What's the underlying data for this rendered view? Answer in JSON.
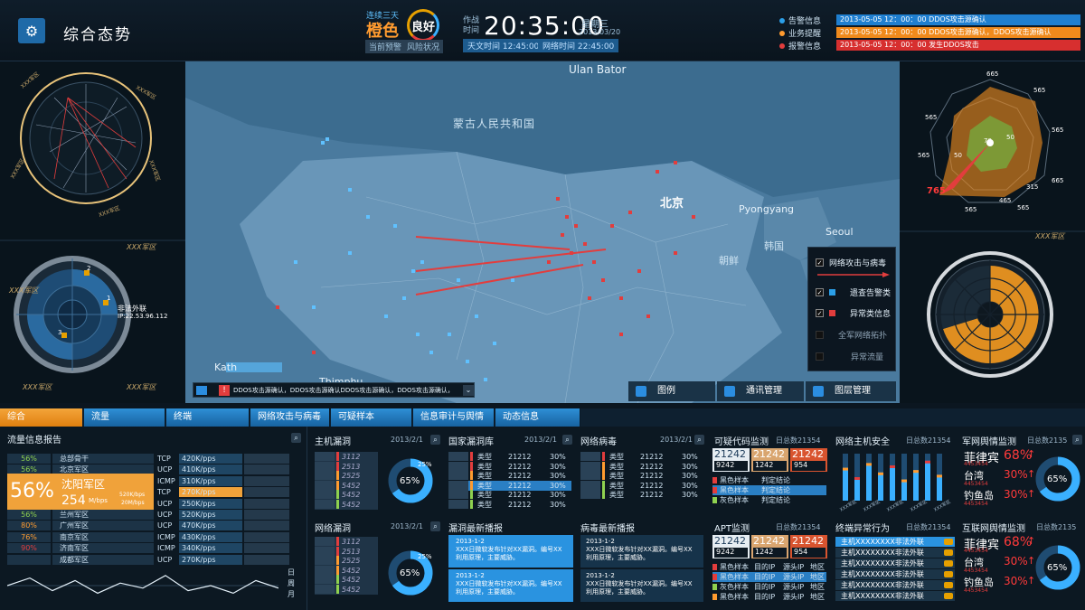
{
  "header": {
    "title": "综合态势",
    "combo_days": "连续三天",
    "level": "橙色",
    "level_label": "当前预警",
    "risk_value": "良好",
    "risk_label": "风险状况",
    "time_label": "作战时间",
    "clock": "20:35:00",
    "weekday": "星期三",
    "date": "2013/03/20",
    "sky_time": "天文时间 12:45:00",
    "net_time": "网络时间 22:45:00",
    "alerts": [
      {
        "label": "告警信息",
        "color": "#2b9fe8",
        "text": "2013-05-05 12：00：00 DDOS攻击源确认"
      },
      {
        "label": "业务提醒",
        "color": "#ff9b2f",
        "text": "2013-05-05 12：00：00 DDOS攻击源确认，DDOS攻击源确认"
      },
      {
        "label": "报警信息",
        "color": "#e23d3d",
        "text": "2013-05-05 12：00：00 发生DDOS攻击"
      }
    ]
  },
  "map": {
    "labels": {
      "ulan_bator": "Ulan Bator",
      "mongolia": "蒙古人民共和国",
      "beijing": "北京",
      "pyongyang": "Pyongyang",
      "seoul": "Seoul",
      "korea_s": "韩国",
      "korea_n": "朝鲜",
      "kath": "Kath",
      "thimphu": "Thimphu"
    },
    "ticker": "DDOS攻击源确认，DDOS攻击源确认DDOS攻击源确认，DDOS攻击源确认，",
    "legend": [
      {
        "label": "网络攻击与病毒",
        "checked": true
      },
      {
        "label": "遗查告警类",
        "checked": true,
        "color": "#2b9fe8"
      },
      {
        "label": "异常类信息",
        "checked": true,
        "color": "#e23d3d"
      },
      {
        "label": "全军网络拓扑",
        "checked": false
      },
      {
        "label": "异常流量",
        "checked": false
      }
    ],
    "buttons": [
      "图例",
      "通讯管理",
      "图层管理"
    ]
  },
  "left": {
    "radar_label": "非法外联",
    "radar_ip": "IP:22.53.96.112",
    "region_labels": [
      "XXX军区",
      "XXX军区",
      "XXX军区",
      "XXX军区"
    ],
    "points": [
      "1",
      "2",
      "3",
      "4"
    ]
  },
  "right": {
    "radar_values": [
      "665",
      "565",
      "565",
      "665",
      "565",
      "565",
      "565",
      "565",
      "765",
      "565",
      "565",
      "665",
      "565",
      "565",
      "565"
    ],
    "inner_values": [
      "50",
      "50",
      "50",
      "50",
      "50",
      "50",
      "50"
    ],
    "mid_values": [
      "35",
      "35",
      "125",
      "315",
      "465",
      "465"
    ],
    "core_value": "70",
    "region_label": "XXX军区"
  },
  "tabs": [
    "综合",
    "流量",
    "终端",
    "网络攻击与病毒",
    "可疑样本",
    "信息审计与舆情",
    "动态信息"
  ],
  "traffic": {
    "title": "流量信息报告",
    "rows": [
      {
        "pct": "56%",
        "name": "总部骨干",
        "proto": "TCP",
        "rate": "420K/pps"
      },
      {
        "pct": "56%",
        "name": "北京军区",
        "proto": "UCP",
        "rate": "410K/pps"
      },
      {
        "pct": "",
        "name": "",
        "proto": "ICMP",
        "rate": "310K/pps"
      },
      {
        "pct": "",
        "name": "",
        "proto": "TCP",
        "rate": "270K/pps"
      },
      {
        "pct": "",
        "name": "",
        "proto": "UCP",
        "rate": "250K/pps"
      },
      {
        "pct": "56%",
        "name": "兰州军区",
        "proto": "UCP",
        "rate": "520K/pps"
      },
      {
        "pct": "80%",
        "name": "广州军区",
        "proto": "UCP",
        "rate": "470K/pps"
      },
      {
        "pct": "76%",
        "name": "南京军区",
        "proto": "ICMP",
        "rate": "430K/pps"
      },
      {
        "pct": "90%",
        "name": "济南军区",
        "proto": "ICMP",
        "rate": "340K/pps"
      },
      {
        "pct": "",
        "name": "成都军区",
        "proto": "UCP",
        "rate": "270K/pps"
      }
    ],
    "highlight_pct": "56%",
    "highlight_name": "沈阳军区",
    "highlight_rate": "254",
    "highlight_unit": "M/bps",
    "highlight_sub1": "520K/bps",
    "highlight_sub2": "20M/bps",
    "range_labels": [
      "日",
      "周",
      "月"
    ],
    "wave": [
      0.5,
      0.8,
      0.3,
      0.7,
      0.2,
      0.6,
      0.4,
      0.9,
      0.3,
      0.5,
      0.2,
      0.7,
      0.4
    ]
  },
  "vuln_panels": [
    {
      "title": "主机漏洞",
      "date": "2013/2/1",
      "rows": [
        "3112",
        "2513",
        "2525",
        "5452",
        "5452",
        "5452"
      ],
      "pct": "65%",
      "sub": "25%"
    },
    {
      "title": "网络漏洞",
      "date": "2013/2/1",
      "rows": [
        "3112",
        "2513",
        "2525",
        "5452",
        "5452",
        "5452"
      ],
      "pct": "65%",
      "sub": "25%"
    }
  ],
  "vuln_lib": {
    "title": "国家漏洞库",
    "date": "2013/2/1",
    "rows": [
      {
        "type": "类型",
        "num": "21212",
        "pct": "30%"
      },
      {
        "type": "类型",
        "num": "21212",
        "pct": "30%"
      },
      {
        "type": "类型",
        "num": "21212",
        "pct": "30%"
      },
      {
        "type": "类型",
        "num": "21212",
        "pct": "30%"
      },
      {
        "type": "类型",
        "num": "21212",
        "pct": "30%"
      },
      {
        "type": "类型",
        "num": "21212",
        "pct": "30%"
      }
    ]
  },
  "virus": {
    "title": "网络病毒",
    "date": "2013/2/1",
    "rows": [
      {
        "type": "类型",
        "num": "21212",
        "pct": "30%"
      },
      {
        "type": "类型",
        "num": "21212",
        "pct": "30%"
      },
      {
        "type": "类型",
        "num": "21212",
        "pct": "30%"
      },
      {
        "type": "类型",
        "num": "21212",
        "pct": "30%"
      },
      {
        "type": "类型",
        "num": "21212",
        "pct": "30%"
      }
    ]
  },
  "vuln_news": {
    "title": "漏洞最新播报",
    "items": [
      {
        "date": "2013-1-2",
        "text": "XXX日微软发布针对XX漏洞。编号XX利用原理，主要威胁。"
      },
      {
        "date": "2013-1-2",
        "text": "XXX日微软发布针对XX漏洞。编号XX利用原理，主要威胁。"
      }
    ]
  },
  "virus_news": {
    "title": "病毒最新播报",
    "items": [
      {
        "date": "2013-1-2",
        "text": "XXX日微软发布针对XX漏洞。编号XX利用原理，主要威胁。"
      },
      {
        "date": "2013-1-2",
        "text": "XXX日微软发布针对XX漏洞。编号XX利用原理，主要威胁。"
      }
    ]
  },
  "suspicious": {
    "title": "可疑代码监测",
    "count": "日总数21354",
    "nums": [
      "21242",
      "21242",
      "21242"
    ],
    "subs": [
      "9242",
      "1242",
      "954"
    ],
    "rows": [
      {
        "a": "黑色样本",
        "b": "判定结论"
      },
      {
        "a": "黑色样本",
        "b": "判定结论"
      },
      {
        "a": "灰色样本",
        "b": "判定结论"
      }
    ]
  },
  "apt": {
    "title": "APT监测",
    "count": "日总数21354",
    "nums": [
      "21242",
      "21242",
      "21242"
    ],
    "subs": [
      "9242",
      "1242",
      "954"
    ],
    "rows": [
      {
        "a": "黑色样本",
        "b": "目的IP",
        "c": "源头IP",
        "d": "地区"
      },
      {
        "a": "黑色样本",
        "b": "目的IP",
        "c": "源头IP",
        "d": "地区"
      },
      {
        "a": "灰色样本",
        "b": "目的IP",
        "c": "源头IP",
        "d": "地区"
      },
      {
        "a": "黑色样本",
        "b": "目的IP",
        "c": "源头IP",
        "d": "地区"
      }
    ]
  },
  "host_security": {
    "title": "网络主机安全",
    "count": "日总数21354",
    "bars": [
      0.7,
      0.5,
      0.8,
      0.6,
      0.75,
      0.45,
      0.65,
      0.85,
      0.55
    ],
    "label": "XXX军区"
  },
  "endpoint": {
    "title": "终端异常行为",
    "count": "日总数21354",
    "rows": [
      "主机XXXXXXXX非法外联",
      "主机XXXXXXXX非法外联",
      "主机XXXXXXXX非法外联",
      "主机XXXXXXXX非法外联",
      "主机XXXXXXXX非法外联",
      "主机XXXXXXXX非法外联"
    ]
  },
  "mil_sentiment": {
    "title": "军网舆情监测",
    "count": "日总数2135",
    "items": [
      {
        "name": "菲律宾",
        "pct": "68%",
        "sub": "4453454"
      },
      {
        "name": "台湾",
        "pct": "30%",
        "sub": "4453454"
      },
      {
        "name": "钓鱼岛",
        "pct": "30%",
        "sub": "4453454"
      }
    ],
    "donut": "65%"
  },
  "web_sentiment": {
    "title": "互联网舆情监测",
    "count": "日总数2135",
    "items": [
      {
        "name": "菲律宾",
        "pct": "68%",
        "sub": "4453454"
      },
      {
        "name": "台湾",
        "pct": "30%",
        "sub": "4453454"
      },
      {
        "name": "钓鱼岛",
        "pct": "30%",
        "sub": "4453454"
      }
    ],
    "donut": "65%"
  },
  "colors": {
    "accent": "#2b9fe8",
    "orange": "#ff9b2f",
    "red": "#e23d3d",
    "green": "#8fd14f"
  }
}
